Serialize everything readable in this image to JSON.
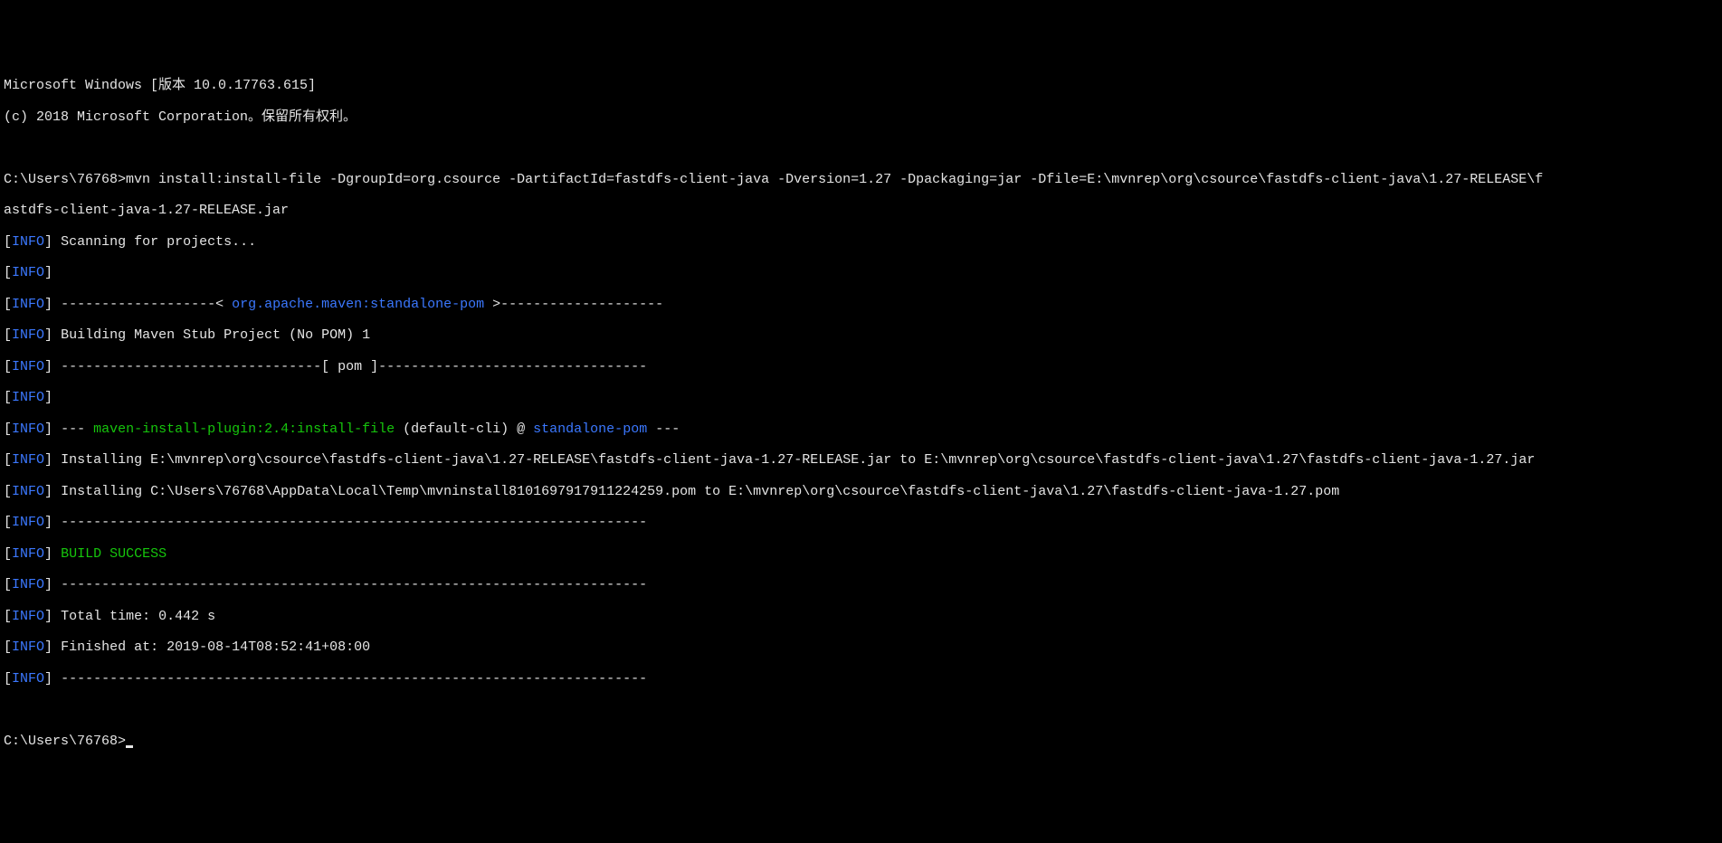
{
  "header": {
    "line1": "Microsoft Windows [版本 10.0.17763.615]",
    "line2": "(c) 2018 Microsoft Corporation。保留所有权利。"
  },
  "prompt1": {
    "path": "C:\\Users\\76768>",
    "command_part1": "mvn install:install-file -DgroupId=org.csource -DartifactId=fastdfs-client-java -Dversion=1.27 -Dpackaging=jar -Dfile=E:\\mvnrep\\org\\csource\\fastdfs-client-java\\1.27-RELEASE\\f",
    "command_part2": "astdfs-client-java-1.27-RELEASE.jar"
  },
  "log": {
    "info_label": "INFO",
    "l1": "Scanning for projects...",
    "l2": "",
    "l3_dash1": "-------------------< ",
    "l3_green": "org.apache.maven:standalone-pom",
    "l3_dash2": " >--------------------",
    "l4": "Building Maven Stub Project (No POM) 1",
    "l5": "--------------------------------[ pom ]---------------------------------",
    "l6": "",
    "l7_dash1": "--- ",
    "l7_green": "maven-install-plugin:2.4:install-file",
    "l7_mid": " (default-cli) @ ",
    "l7_blue": "standalone-pom",
    "l7_dash2": " ---",
    "l8": "Installing E:\\mvnrep\\org\\csource\\fastdfs-client-java\\1.27-RELEASE\\fastdfs-client-java-1.27-RELEASE.jar to E:\\mvnrep\\org\\csource\\fastdfs-client-java\\1.27\\fastdfs-client-java-1.27.jar",
    "l9": "Installing C:\\Users\\76768\\AppData\\Local\\Temp\\mvninstall8101697917911224259.pom to E:\\mvnrep\\org\\csource\\fastdfs-client-java\\1.27\\fastdfs-client-java-1.27.pom",
    "l10": "------------------------------------------------------------------------",
    "l11_green": "BUILD SUCCESS",
    "l12": "------------------------------------------------------------------------",
    "l13": "Total time: 0.442 s",
    "l14": "Finished at: 2019-08-14T08:52:41+08:00",
    "l15": "------------------------------------------------------------------------"
  },
  "prompt2": {
    "path": "C:\\Users\\76768>"
  }
}
